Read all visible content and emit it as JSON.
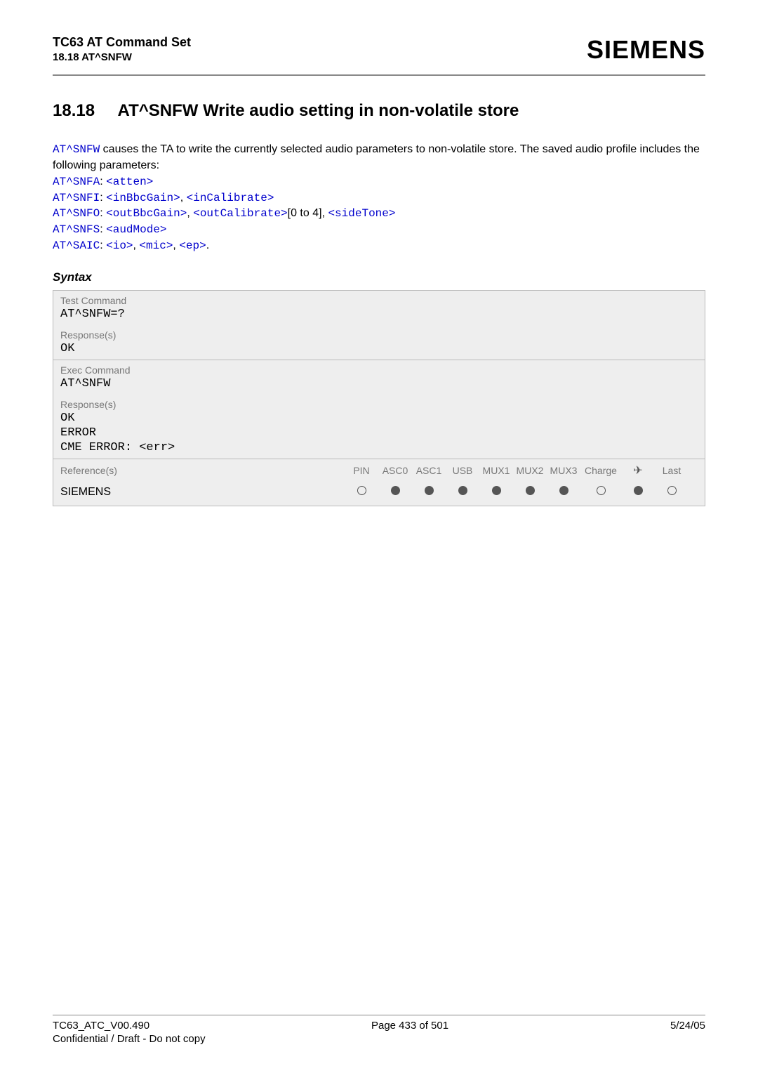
{
  "header": {
    "title": "TC63 AT Command Set",
    "sub": "18.18 AT^SNFW",
    "brand": "SIEMENS"
  },
  "section": {
    "number": "18.18",
    "title": "AT^SNFW   Write audio setting in non-volatile store"
  },
  "intro": {
    "cmd": "AT^SNFW",
    "text1": " causes the TA to write the currently selected audio parameters to non-volatile store. The saved audio profile includes the following parameters:"
  },
  "params": {
    "snfa_cmd": "AT^SNFA",
    "snfa_colon": ": ",
    "snfa_p1": "<atten>",
    "snfi_cmd": "AT^SNFI",
    "snfi_colon": ": ",
    "snfi_p1": "<inBbcGain>",
    "snfi_sep": ", ",
    "snfi_p2": "<inCalibrate>",
    "snfo_cmd": "AT^SNFO",
    "snfo_colon": ": ",
    "snfo_p1": "<outBbcGain>",
    "snfo_sep1": ", ",
    "snfo_p2": "<outCalibrate>",
    "snfo_range": "[0 to 4], ",
    "snfo_p3": "<sideTone>",
    "snfs_cmd": "AT^SNFS",
    "snfs_colon": ": ",
    "snfs_p1": "<audMode>",
    "saic_cmd": "AT^SAIC",
    "saic_colon": ": ",
    "saic_p1": "<io>",
    "saic_sep1": ", ",
    "saic_p2": "<mic>",
    "saic_sep2": ", ",
    "saic_p3": "<ep>",
    "saic_end": "."
  },
  "syntax_label": "Syntax",
  "box": {
    "test_label": "Test Command",
    "test_cmd": "AT^SNFW=?",
    "resp_label1": "Response(s)",
    "resp1_l1": "OK",
    "exec_label": "Exec Command",
    "exec_cmd": "AT^SNFW",
    "resp_label2": "Response(s)",
    "resp2_l1": "OK",
    "resp2_l2": "ERROR",
    "resp2_l3": "CME ERROR: <err>",
    "ref_label": "Reference(s)",
    "ref_value": "SIEMENS",
    "cols": {
      "pin": "PIN",
      "asc0": "ASC0",
      "asc1": "ASC1",
      "usb": "USB",
      "mux1": "MUX1",
      "mux2": "MUX2",
      "mux3": "MUX3",
      "charge": "Charge",
      "arrow": "✈",
      "last": "Last"
    }
  },
  "footer": {
    "left": "TC63_ATC_V00.490",
    "center": "Page 433 of 501",
    "right": "5/24/05",
    "sub": "Confidential / Draft - Do not copy"
  }
}
